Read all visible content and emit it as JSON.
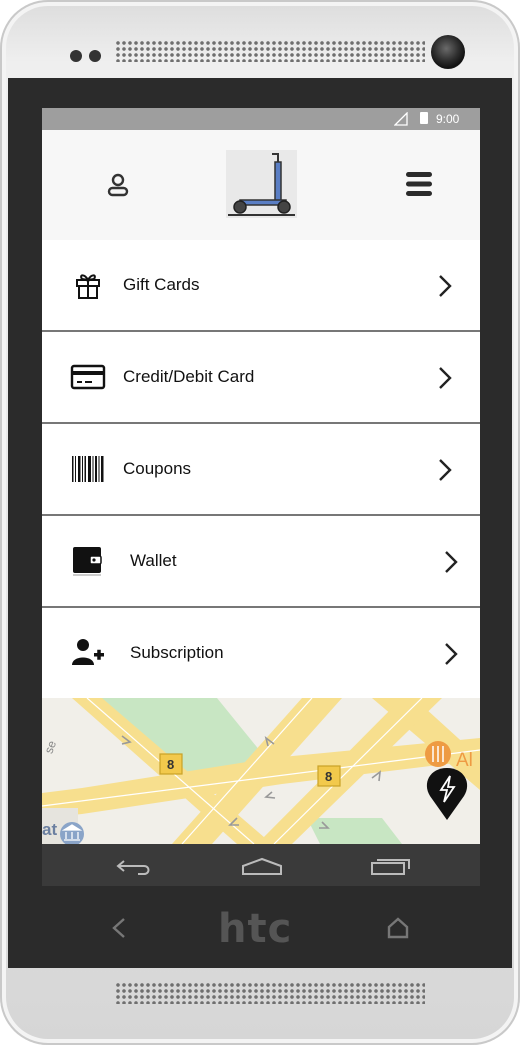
{
  "device": {
    "brand": "htc"
  },
  "status_bar": {
    "time": "9:00",
    "signal_icon": "signal-icon",
    "battery_icon": "battery-icon"
  },
  "header": {
    "profile_icon": "user-icon",
    "logo_icon": "scooter-logo-icon",
    "menu_icon": "hamburger-menu-icon"
  },
  "menu": {
    "items": [
      {
        "label": "Gift Cards",
        "icon": "gift-icon"
      },
      {
        "label": "Credit/Debit Card",
        "icon": "credit-card-icon"
      },
      {
        "label": "Coupons",
        "icon": "barcode-icon"
      },
      {
        "label": "Wallet",
        "icon": "wallet-icon"
      },
      {
        "label": "Subscription",
        "icon": "add-user-icon"
      }
    ]
  },
  "map": {
    "road_labels": [
      "8",
      "8"
    ],
    "poi_label": "Al",
    "partial_text_left": "at",
    "street_fragment": "se",
    "marker_icon": "charging-station-marker-icon"
  },
  "colors": {
    "accent": "#5a7ec4",
    "map_road": "#f7df8e",
    "map_park": "#c8e6c3",
    "poi": "#ee9b43"
  }
}
